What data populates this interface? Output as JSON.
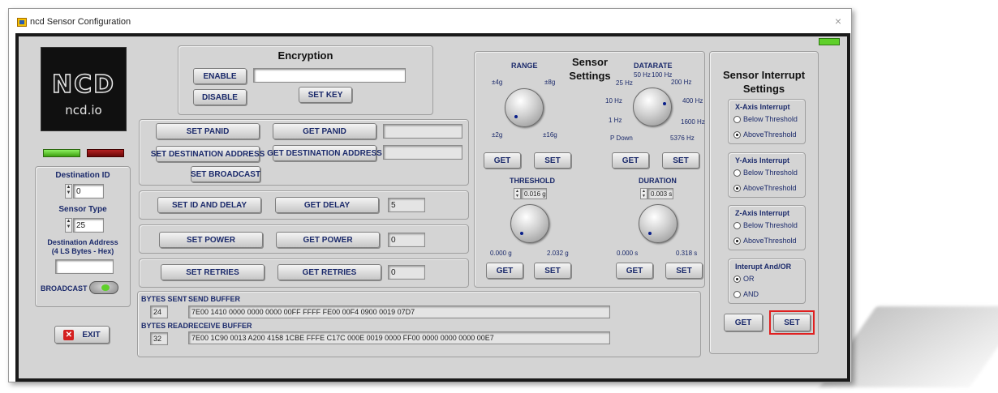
{
  "window": {
    "title": "ncd Sensor Configuration",
    "close": "×"
  },
  "logo": {
    "mark": "NCD",
    "text": "ncd.io"
  },
  "left": {
    "dest_id_label": "Destination ID",
    "dest_id_value": "0",
    "sensor_type_label": "Sensor Type",
    "sensor_type_value": "25",
    "dest_addr_label": "Destination Address",
    "dest_addr_sub": "(4 LS Bytes - Hex)",
    "dest_addr_value": "",
    "broadcast_label": "BROADCAST",
    "exit_label": "EXIT"
  },
  "encryption": {
    "title": "Encryption",
    "enable": "ENABLE",
    "disable": "DISABLE",
    "set_key": "SET KEY",
    "key_value": ""
  },
  "network": {
    "set_panid": "SET PANID",
    "get_panid": "GET PANID",
    "panid_value": "",
    "set_dest": "SET DESTINATION ADDRESS",
    "get_dest": "GET DESTINATION ADDRESS",
    "dest_value": "",
    "set_broadcast": "SET BROADCAST"
  },
  "delay": {
    "set": "SET ID AND DELAY",
    "get": "GET DELAY",
    "value": "5"
  },
  "power": {
    "set": "SET POWER",
    "get": "GET POWER",
    "value": "0"
  },
  "retries": {
    "set": "SET RETRIES",
    "get": "GET RETRIES",
    "value": "0"
  },
  "buffers": {
    "bytes_sent_label": "BYTES SENT",
    "bytes_sent": "24",
    "send_label": "SEND BUFFER",
    "send": "7E00 1410 0000 0000 0000 00FF FFFF FE00 00F4 0900 0019 07D7",
    "bytes_read_label": "BYTES READ",
    "bytes_read": "32",
    "recv_label": "RECEIVE BUFFER",
    "recv": "7E00 1C90 0013 A200 4158 1CBE FFFE C17C 000E 0019 0000 FF00 0000 0000 0000 00E7"
  },
  "sensor": {
    "title": "Sensor Settings",
    "range_label": "RANGE",
    "range_ticks": {
      "tl": "±4g",
      "tr": "±8g",
      "bl": "±2g",
      "br": "±16g"
    },
    "datarate_label": "DATARATE",
    "datarate_ticks": {
      "t1": "50 Hz",
      "t2": "100 Hz",
      "t3": "25 Hz",
      "t4": "200 Hz",
      "t5": "10 Hz",
      "t6": "400 Hz",
      "t7": "1 Hz",
      "t8": "1600 Hz",
      "t9": "P Down",
      "t10": "5376 Hz"
    },
    "threshold_label": "THRESHOLD",
    "threshold_value": "0.016 g",
    "threshold_min": "0.000 g",
    "threshold_max": "2.032 g",
    "duration_label": "DURATION",
    "duration_value": "0.003 s",
    "duration_min": "0.000 s",
    "duration_max": "0.318 s",
    "get": "GET",
    "set": "SET"
  },
  "interrupt": {
    "title": "Sensor Interrupt Settings",
    "x_label": "X-Axis Interrupt",
    "y_label": "Y-Axis Interrupt",
    "z_label": "Z-Axis Interrupt",
    "below": "Below Threshold",
    "above": "AboveThreshold",
    "andor_label": "Interupt And/OR",
    "or": "OR",
    "and": "AND",
    "get": "GET",
    "set": "SET"
  },
  "colors": {
    "led_green": "#5fd02a",
    "led_red": "#8a1010",
    "highlight": "#e02020"
  }
}
